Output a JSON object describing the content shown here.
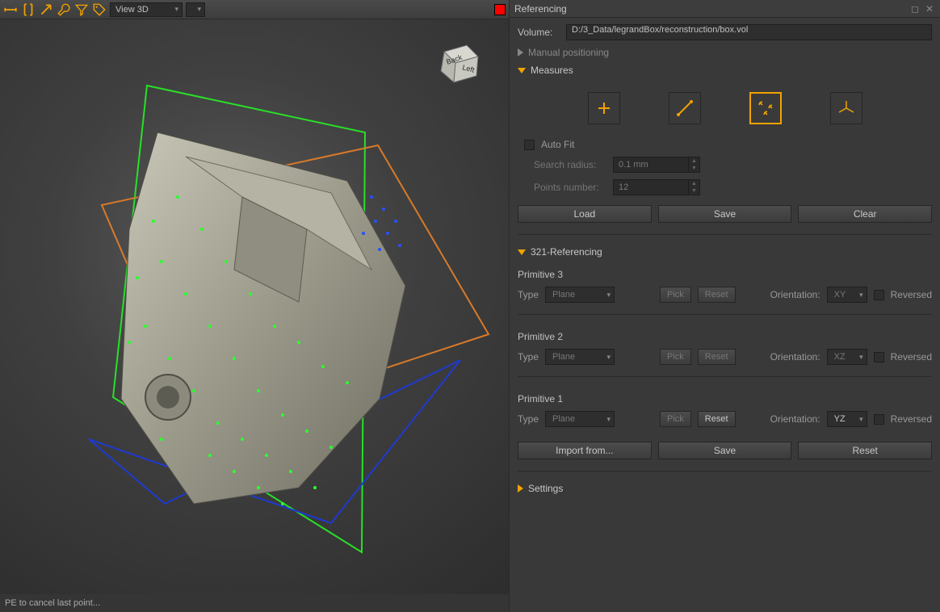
{
  "toolbar": {
    "combo_view": "View 3D"
  },
  "status": {
    "text": "PE to cancel last point..."
  },
  "panel": {
    "title": "Referencing",
    "volume_label": "Volume:",
    "volume_path": "D:/3_Data/legrandBox/reconstruction/box.vol",
    "sections": {
      "manual": {
        "title": "Manual positioning"
      },
      "measures": {
        "title": "Measures",
        "autofit_label": "Auto Fit",
        "search_radius_label": "Search radius:",
        "search_radius_value": "0.1 mm",
        "points_number_label": "Points number:",
        "points_number_value": "12",
        "btn_load": "Load",
        "btn_save": "Save",
        "btn_clear": "Clear"
      },
      "ref321": {
        "title": "321-Referencing",
        "type_label": "Type",
        "pick_label": "Pick",
        "reset_label": "Reset",
        "orientation_label": "Orientation:",
        "reversed_label": "Reversed",
        "btn_import": "Import from...",
        "btn_save": "Save",
        "btn_reset": "Reset",
        "primitives": [
          {
            "name": "Primitive 3",
            "type": "Plane",
            "orientation": "XY",
            "enabled": false
          },
          {
            "name": "Primitive 2",
            "type": "Plane",
            "orientation": "XZ",
            "enabled": false
          },
          {
            "name": "Primitive 1",
            "type": "Plane",
            "orientation": "YZ",
            "enabled": true
          }
        ]
      },
      "settings": {
        "title": "Settings"
      }
    }
  },
  "cube": {
    "face1": "Back",
    "face2": "Left"
  }
}
